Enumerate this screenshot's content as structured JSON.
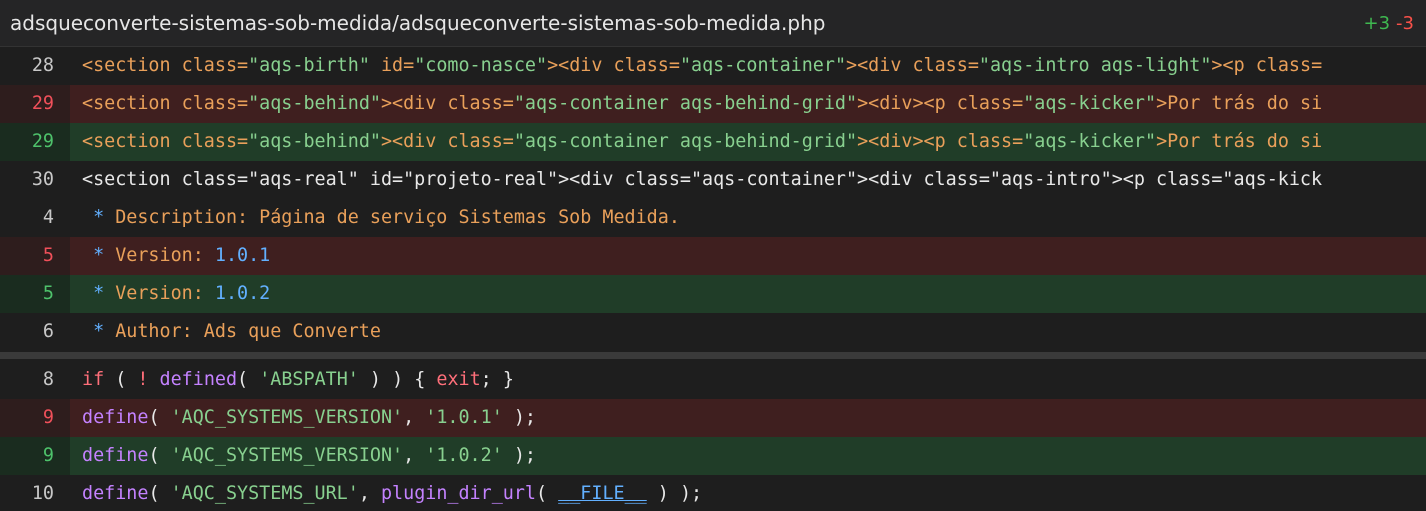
{
  "file": {
    "path": "adsqueconverte-sistemas-sob-medida/adsqueconverte-sistemas-sob-medida.php",
    "additions": "+3",
    "deletions": "-3"
  },
  "colors": {
    "added_bg": "#203d28",
    "removed_bg": "#3f1f1f",
    "added_number": "#4ec26b",
    "removed_number": "#f0505a"
  },
  "hunks": [
    {
      "lines": [
        {
          "number": "28",
          "kind": "context",
          "tokens": [
            {
              "c": "t-tag",
              "t": "<section "
            },
            {
              "c": "t-attr",
              "t": "class="
            },
            {
              "c": "t-str",
              "t": "\"aqs-birth\""
            },
            {
              "c": "t-attr",
              "t": " id="
            },
            {
              "c": "t-str",
              "t": "\"como-nasce\""
            },
            {
              "c": "t-tag",
              "t": "><div "
            },
            {
              "c": "t-attr",
              "t": "class="
            },
            {
              "c": "t-str",
              "t": "\"aqs-container\""
            },
            {
              "c": "t-tag",
              "t": "><div "
            },
            {
              "c": "t-attr",
              "t": "class="
            },
            {
              "c": "t-str",
              "t": "\"aqs-intro aqs-light\""
            },
            {
              "c": "t-tag",
              "t": "><p "
            },
            {
              "c": "t-attr",
              "t": "class="
            }
          ]
        },
        {
          "number": "29",
          "kind": "removed",
          "tokens": [
            {
              "c": "t-tag",
              "t": "<section "
            },
            {
              "c": "t-attr",
              "t": "class="
            },
            {
              "c": "t-str",
              "t": "\"aqs-behind\""
            },
            {
              "c": "t-tag",
              "t": "><div "
            },
            {
              "c": "t-attr",
              "t": "class="
            },
            {
              "c": "t-str",
              "t": "\"aqs-container aqs-behind-grid\""
            },
            {
              "c": "t-tag",
              "t": "><div><p "
            },
            {
              "c": "t-attr",
              "t": "class="
            },
            {
              "c": "t-str",
              "t": "\"aqs-kicker\""
            },
            {
              "c": "t-tag",
              "t": ">"
            },
            {
              "c": "t-text",
              "t": "Por trás do si"
            }
          ]
        },
        {
          "number": "29",
          "kind": "added",
          "tokens": [
            {
              "c": "t-tag",
              "t": "<section "
            },
            {
              "c": "t-attr",
              "t": "class="
            },
            {
              "c": "t-str",
              "t": "\"aqs-behind\""
            },
            {
              "c": "t-tag",
              "t": "><div "
            },
            {
              "c": "t-attr",
              "t": "class="
            },
            {
              "c": "t-str",
              "t": "\"aqs-container aqs-behind-grid\""
            },
            {
              "c": "t-tag",
              "t": "><div><p "
            },
            {
              "c": "t-attr",
              "t": "class="
            },
            {
              "c": "t-str",
              "t": "\"aqs-kicker\""
            },
            {
              "c": "t-tag",
              "t": ">"
            },
            {
              "c": "t-text",
              "t": "Por trás do si"
            }
          ]
        },
        {
          "number": "30",
          "kind": "context",
          "tokens": [
            {
              "c": "t-plain",
              "t": "<section class=\"aqs-real\" id=\"projeto-real\"><div class=\"aqs-container\"><div class=\"aqs-intro\"><p class=\"aqs-kick"
            }
          ]
        },
        {
          "number": "4",
          "kind": "context",
          "tokens": [
            {
              "c": "t-star",
              "t": " * "
            },
            {
              "c": "t-cmt",
              "t": "Description: Página de serviço Sistemas Sob Medida."
            }
          ]
        },
        {
          "number": "5",
          "kind": "removed",
          "tokens": [
            {
              "c": "t-star",
              "t": " * "
            },
            {
              "c": "t-cmt",
              "t": "Version: "
            },
            {
              "c": "t-num",
              "t": "1.0.1"
            }
          ]
        },
        {
          "number": "5",
          "kind": "added",
          "tokens": [
            {
              "c": "t-star",
              "t": " * "
            },
            {
              "c": "t-cmt",
              "t": "Version: "
            },
            {
              "c": "t-num",
              "t": "1.0.2"
            }
          ]
        },
        {
          "number": "6",
          "kind": "context",
          "tokens": [
            {
              "c": "t-star",
              "t": " * "
            },
            {
              "c": "t-cmt",
              "t": "Author: Ads que Converte"
            }
          ]
        }
      ]
    },
    {
      "lines": [
        {
          "number": "8",
          "kind": "context",
          "tokens": [
            {
              "c": "t-kw",
              "t": "if"
            },
            {
              "c": "t-plain",
              "t": " ( "
            },
            {
              "c": "t-kw",
              "t": "!"
            },
            {
              "c": "t-plain",
              "t": " "
            },
            {
              "c": "t-fn",
              "t": "defined"
            },
            {
              "c": "t-plain",
              "t": "( "
            },
            {
              "c": "t-str",
              "t": "'ABSPATH'"
            },
            {
              "c": "t-plain",
              "t": " ) ) { "
            },
            {
              "c": "t-kw",
              "t": "exit"
            },
            {
              "c": "t-plain",
              "t": "; }"
            }
          ]
        },
        {
          "number": "9",
          "kind": "removed",
          "tokens": [
            {
              "c": "t-fn",
              "t": "define"
            },
            {
              "c": "t-plain",
              "t": "( "
            },
            {
              "c": "t-str",
              "t": "'AQC_SYSTEMS_VERSION'"
            },
            {
              "c": "t-plain",
              "t": ", "
            },
            {
              "c": "t-str",
              "t": "'1.0.1'"
            },
            {
              "c": "t-plain",
              "t": " );"
            }
          ]
        },
        {
          "number": "9",
          "kind": "added",
          "tokens": [
            {
              "c": "t-fn",
              "t": "define"
            },
            {
              "c": "t-plain",
              "t": "( "
            },
            {
              "c": "t-str",
              "t": "'AQC_SYSTEMS_VERSION'"
            },
            {
              "c": "t-plain",
              "t": ", "
            },
            {
              "c": "t-str",
              "t": "'1.0.2'"
            },
            {
              "c": "t-plain",
              "t": " );"
            }
          ]
        },
        {
          "number": "10",
          "kind": "context",
          "tokens": [
            {
              "c": "t-fn",
              "t": "define"
            },
            {
              "c": "t-plain",
              "t": "( "
            },
            {
              "c": "t-str",
              "t": "'AQC_SYSTEMS_URL'"
            },
            {
              "c": "t-plain",
              "t": ", "
            },
            {
              "c": "t-fn",
              "t": "plugin_dir_url"
            },
            {
              "c": "t-plain",
              "t": "( "
            },
            {
              "c": "t-const",
              "t": "__FILE__"
            },
            {
              "c": "t-plain",
              "t": " ) );"
            }
          ]
        }
      ]
    }
  ]
}
